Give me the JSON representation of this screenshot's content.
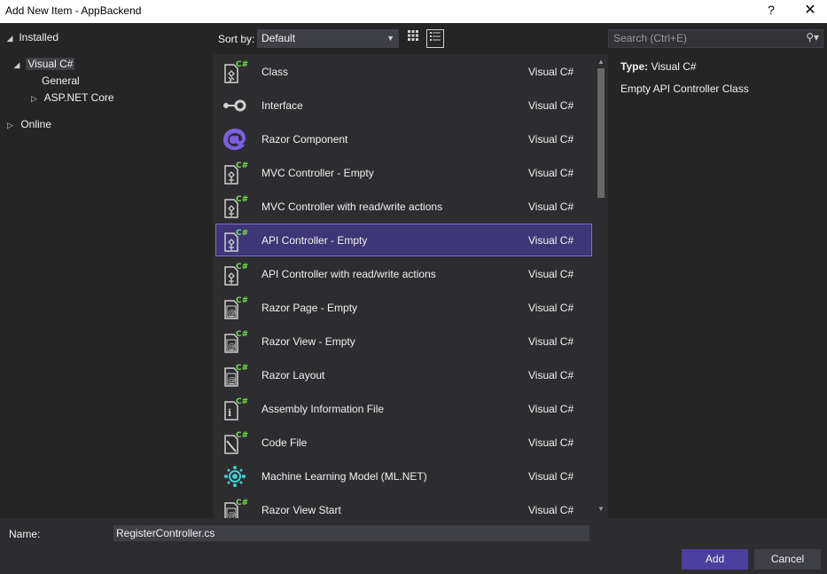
{
  "window": {
    "title": "Add New Item - AppBackend",
    "help_label": "?",
    "close_label": "✕"
  },
  "tree": {
    "installed": "Installed",
    "visual_csharp": "Visual C#",
    "general": "General",
    "aspnet_core": "ASP.NET Core",
    "online": "Online"
  },
  "toolbar": {
    "sort_label": "Sort by:",
    "sort_value": "Default",
    "search_placeholder": "Search (Ctrl+E)"
  },
  "items": [
    {
      "name": "Class",
      "lang": "Visual C#",
      "icon": "class-icon",
      "selected": false
    },
    {
      "name": "Interface",
      "lang": "Visual C#",
      "icon": "interface-icon",
      "selected": false
    },
    {
      "name": "Razor Component",
      "lang": "Visual C#",
      "icon": "razor-component-icon",
      "selected": false
    },
    {
      "name": "MVC Controller - Empty",
      "lang": "Visual C#",
      "icon": "controller-icon",
      "selected": false
    },
    {
      "name": "MVC Controller with read/write actions",
      "lang": "Visual C#",
      "icon": "controller-icon",
      "selected": false
    },
    {
      "name": "API Controller - Empty",
      "lang": "Visual C#",
      "icon": "controller-icon",
      "selected": true
    },
    {
      "name": "API Controller with read/write actions",
      "lang": "Visual C#",
      "icon": "controller-icon",
      "selected": false
    },
    {
      "name": "Razor Page - Empty",
      "lang": "Visual C#",
      "icon": "razor-page-icon",
      "selected": false
    },
    {
      "name": "Razor View - Empty",
      "lang": "Visual C#",
      "icon": "razor-page-icon",
      "selected": false
    },
    {
      "name": "Razor Layout",
      "lang": "Visual C#",
      "icon": "razor-page-icon",
      "selected": false
    },
    {
      "name": "Assembly Information File",
      "lang": "Visual C#",
      "icon": "info-file-icon",
      "selected": false
    },
    {
      "name": "Code File",
      "lang": "Visual C#",
      "icon": "code-file-icon",
      "selected": false
    },
    {
      "name": "Machine Learning Model (ML.NET)",
      "lang": "Visual C#",
      "icon": "ml-model-icon",
      "selected": false
    },
    {
      "name": "Razor View Start",
      "lang": "Visual C#",
      "icon": "razor-page-icon",
      "selected": false
    }
  ],
  "detail": {
    "type_label": "Type:",
    "type_value": "Visual C#",
    "description": "Empty API Controller Class"
  },
  "bottom": {
    "name_label": "Name:",
    "name_value": "RegisterController.cs",
    "add_label": "Add",
    "cancel_label": "Cancel"
  },
  "colors": {
    "background": "#252526",
    "selection": "#3e3676",
    "accent": "#4b3f9e",
    "csharp_badge": "#7ed957"
  }
}
